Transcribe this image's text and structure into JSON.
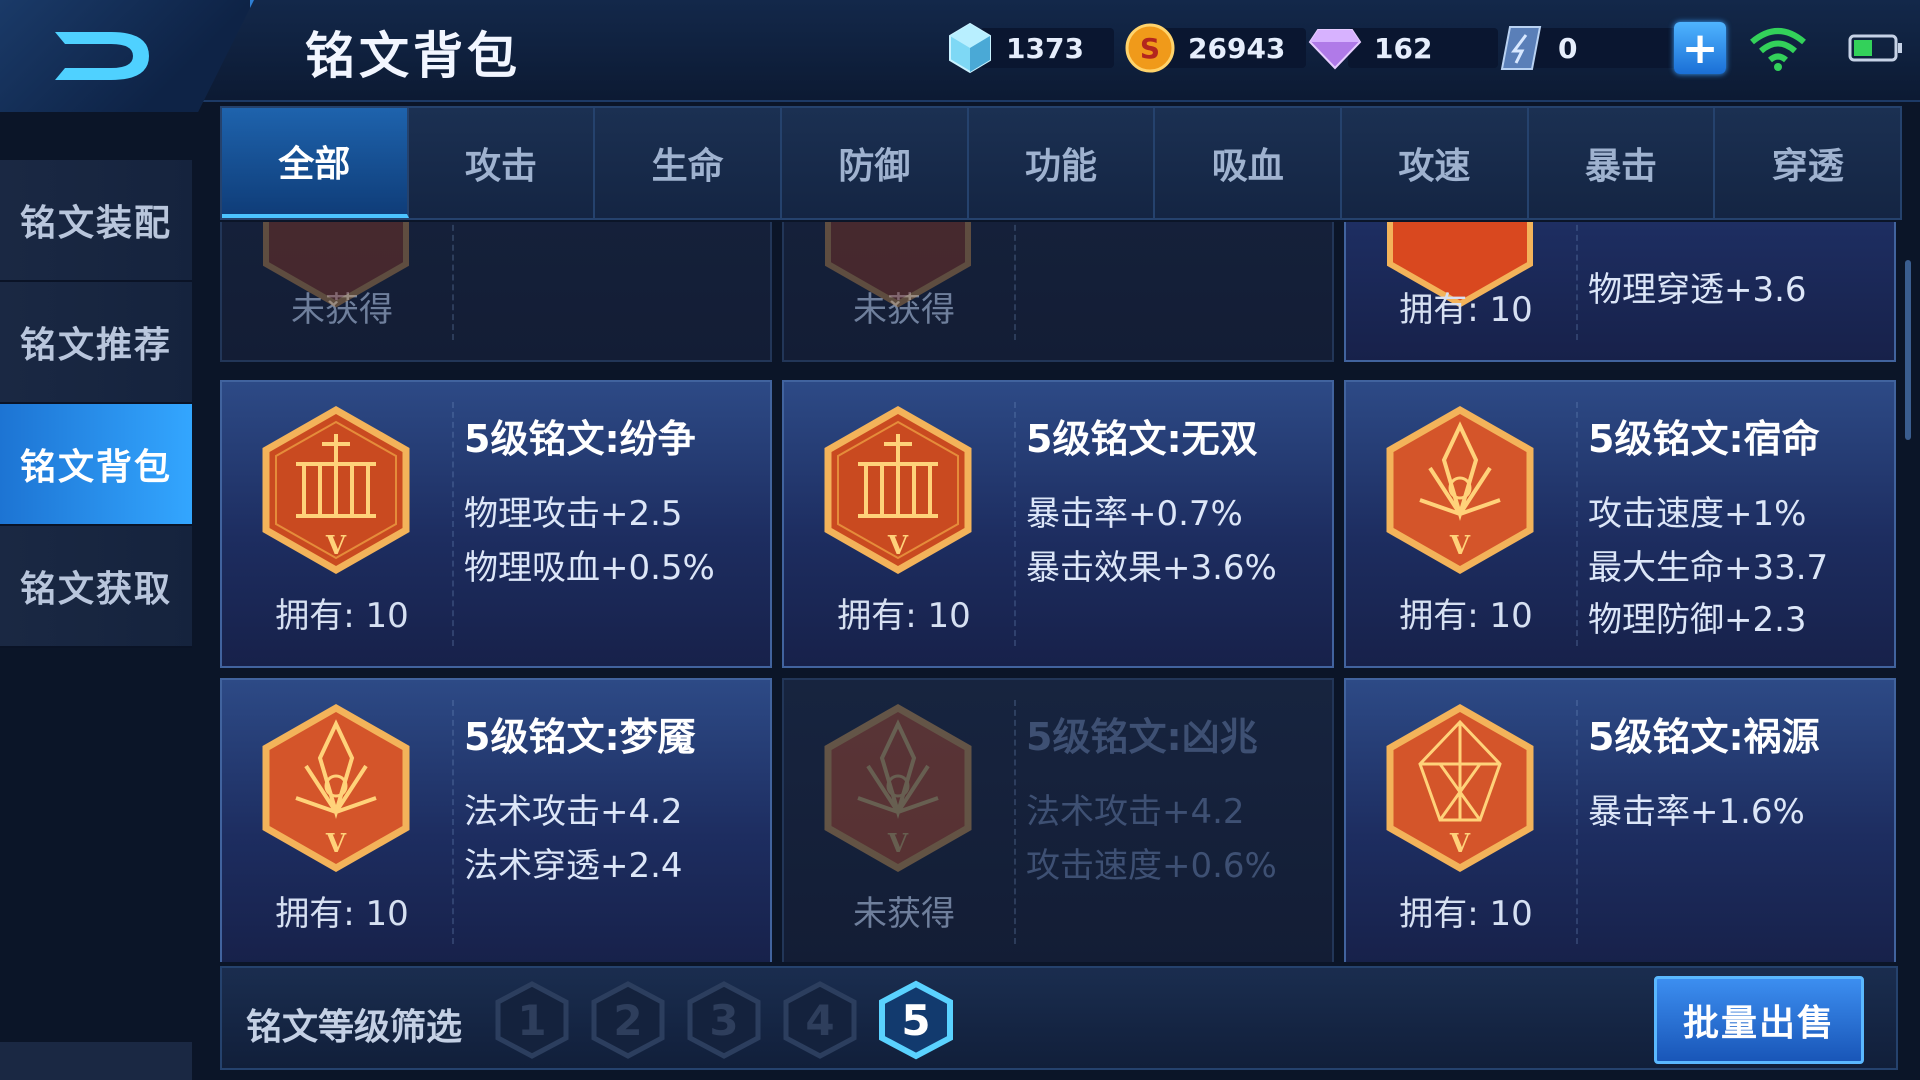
{
  "header": {
    "title": "铭文背包"
  },
  "currencies": [
    {
      "icon": "crystal-icon",
      "value": "1373"
    },
    {
      "icon": "gold-coin-icon",
      "value": "26943"
    },
    {
      "icon": "diamond-icon",
      "value": "162"
    },
    {
      "icon": "voucher-icon",
      "value": "0"
    }
  ],
  "sidebar": {
    "items": [
      {
        "label": "铭文装配",
        "active": false
      },
      {
        "label": "铭文推荐",
        "active": false
      },
      {
        "label": "铭文背包",
        "active": true
      },
      {
        "label": "铭文获取",
        "active": false
      }
    ]
  },
  "tabs": [
    "全部",
    "攻击",
    "生命",
    "防御",
    "功能",
    "吸血",
    "攻速",
    "暴击",
    "穿透"
  ],
  "active_tab": "全部",
  "partial_row": [
    {
      "owned": "未获得",
      "stats": [],
      "locked": true
    },
    {
      "owned": "未获得",
      "stats": [],
      "locked": true
    },
    {
      "owned": "拥有: 10",
      "stats": [
        "物理穿透+3.6"
      ],
      "locked": false
    }
  ],
  "cards": [
    {
      "title": "5级铭文:纷争",
      "stats": [
        "物理攻击+2.5",
        "物理吸血+0.5%"
      ],
      "owned": "拥有: 10",
      "locked": false,
      "emblem": "pillar"
    },
    {
      "title": "5级铭文:无双",
      "stats": [
        "暴击率+0.7%",
        "暴击效果+3.6%"
      ],
      "owned": "拥有: 10",
      "locked": false,
      "emblem": "pillar"
    },
    {
      "title": "5级铭文:宿命",
      "stats": [
        "攻击速度+1%",
        "最大生命+33.7",
        "物理防御+2.3"
      ],
      "owned": "拥有: 10",
      "locked": false,
      "emblem": "crystal"
    },
    {
      "title": "5级铭文:梦魇",
      "stats": [
        "法术攻击+4.2",
        "法术穿透+2.4"
      ],
      "owned": "拥有: 10",
      "locked": false,
      "emblem": "crystal"
    },
    {
      "title": "5级铭文:凶兆",
      "stats": [
        "法术攻击+4.2",
        "攻击速度+0.6%"
      ],
      "owned": "未获得",
      "locked": true,
      "emblem": "crystal"
    },
    {
      "title": "5级铭文:祸源",
      "stats": [
        "暴击率+1.6%"
      ],
      "owned": "拥有: 10",
      "locked": false,
      "emblem": "shard"
    }
  ],
  "emblem_level": "V",
  "filter": {
    "label": "铭文等级筛选",
    "levels": [
      "1",
      "2",
      "3",
      "4",
      "5"
    ],
    "selected": "5"
  },
  "sell_button": "批量出售",
  "colors": {
    "accent": "#33a6ff",
    "card_bg": "#2d4a86",
    "emblem_red": "#d9481f",
    "emblem_gold": "#f3b35a"
  }
}
